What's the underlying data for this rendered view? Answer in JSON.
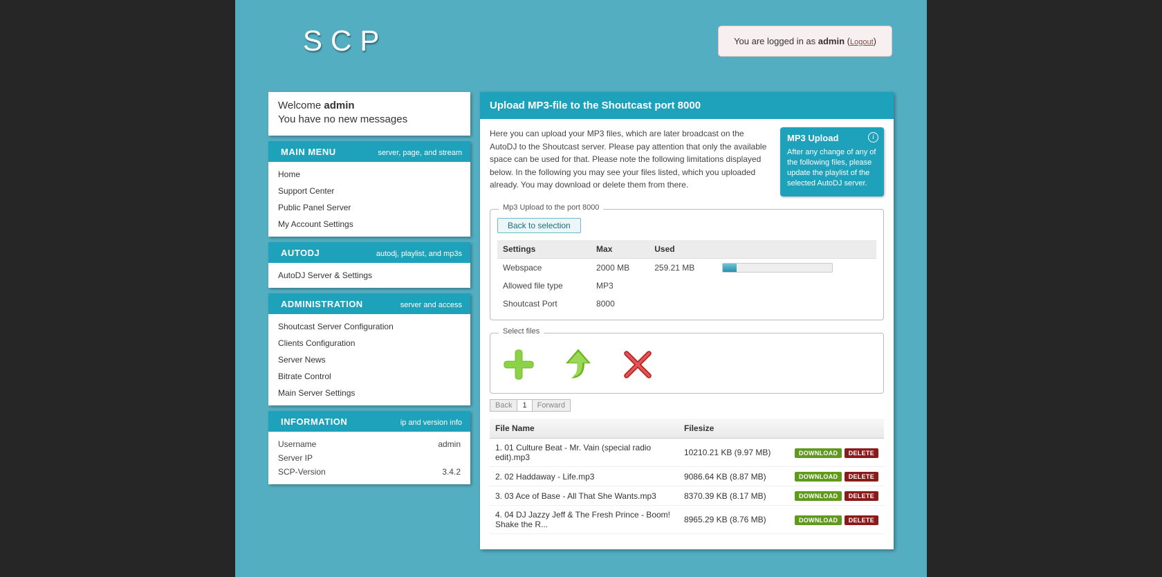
{
  "header": {
    "logo_text": "SCP",
    "login_prefix": "You are logged in as ",
    "login_user": "admin",
    "login_open": " (",
    "logout_label": "Logout",
    "login_close": ")"
  },
  "welcome": {
    "line1_prefix": "Welcome ",
    "user": "admin",
    "line2": "You have no new messages"
  },
  "menus": [
    {
      "id": "main",
      "title": "MAIN MENU",
      "sub": "server, page, and stream",
      "items": [
        "Home",
        "Support Center",
        "Public Panel Server",
        "My Account Settings"
      ]
    },
    {
      "id": "autodj",
      "title": "AUTODJ",
      "sub": "autodj, playlist, and mp3s",
      "items": [
        "AutoDJ Server & Settings"
      ]
    },
    {
      "id": "admin",
      "title": "ADMINISTRATION",
      "sub": "server and access",
      "items": [
        "Shoutcast Server Configuration",
        "Clients Configuration",
        "Server News",
        "Bitrate Control",
        "Main Server Settings"
      ]
    }
  ],
  "info_section": {
    "title": "INFORMATION",
    "sub": "ip and version info",
    "rows": [
      {
        "label": "Username",
        "value": "admin"
      },
      {
        "label": "Server IP",
        "value": " "
      },
      {
        "label": "SCP-Version",
        "value": "3.4.2"
      }
    ]
  },
  "main": {
    "title": "Upload MP3-file to the Shoutcast port 8000",
    "intro": "Here you can upload your MP3 files, which are later broadcast on the AutoDJ to the Shoutcast server. Please pay attention that only the available space can be used for that. Please note the following limitations displayed below. In the following you may see your files listed, which you uploaded already. You may download or delete them from there.",
    "side_note": {
      "title": "MP3 Upload",
      "body": "After any change of any of the following files, please update the playlist of the selected AutoDJ server."
    },
    "fieldset1_legend": "Mp3 Upload to the port 8000",
    "back_button": "Back to selection",
    "settings_headers": [
      "Settings",
      "Max",
      "Used",
      ""
    ],
    "settings_rows": [
      {
        "label": "Webspace",
        "max": "2000 MB",
        "used": "259.21 MB",
        "progress_pct": 13
      },
      {
        "label": "Allowed file type",
        "max": "MP3",
        "used": "",
        "progress_pct": null
      },
      {
        "label": "Shoutcast Port",
        "max": "8000",
        "used": "",
        "progress_pct": null
      }
    ],
    "fieldset2_legend": "Select files",
    "pager": {
      "back": "Back",
      "current": "1",
      "forward": "Forward"
    },
    "file_headers": [
      "File Name",
      "Filesize",
      ""
    ],
    "file_actions": {
      "download": "DOWNLOAD",
      "delete": "DELETE"
    },
    "files": [
      {
        "idx": "1.",
        "name": "01 Culture Beat - Mr. Vain (special radio edit).mp3",
        "size": "10210.21 KB (9.97 MB)"
      },
      {
        "idx": "2.",
        "name": "02 Haddaway - Life.mp3",
        "size": "9086.64 KB (8.87 MB)"
      },
      {
        "idx": "3.",
        "name": "03 Ace of Base - All That She Wants.mp3",
        "size": "8370.39 KB (8.17 MB)"
      },
      {
        "idx": "4.",
        "name": "04 DJ Jazzy Jeff & The Fresh Prince - Boom! Shake the R...",
        "size": "8965.29 KB (8.76 MB)"
      }
    ]
  }
}
